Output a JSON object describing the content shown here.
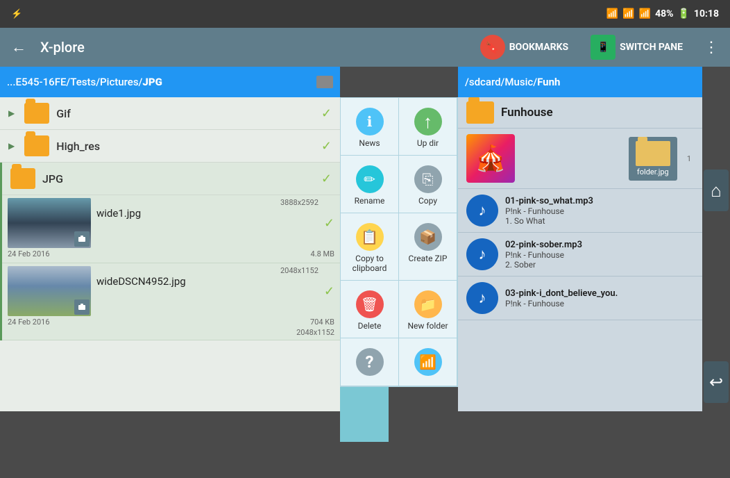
{
  "statusBar": {
    "usb_icon": "⚡",
    "bluetooth_icon": "bluetooth",
    "wifi_icon": "wifi",
    "signal_icon": "signal",
    "battery": "48%",
    "time": "10:18"
  },
  "appBar": {
    "back_label": "←",
    "title": "X-plore",
    "bookmarks_label": "BOOKMARKS",
    "switch_pane_label": "SWITCH PANE"
  },
  "leftPane": {
    "path": "...E545-16FE/Tests/Pictures/",
    "path_bold": "JPG",
    "folders": [
      {
        "name": "Gif"
      },
      {
        "name": "High_res"
      },
      {
        "name": "JPG"
      }
    ],
    "images": [
      {
        "name": "wide1",
        "ext": ".jpg",
        "dimensions": "3888x2592",
        "date": "24 Feb 2016",
        "size": "4.8 MB",
        "dim2": "2048x1152"
      },
      {
        "name": "wideDSCN4952",
        "ext": ".jpg",
        "dimensions": "2048x1152",
        "date": "24 Feb 2016",
        "size": "704 KB"
      }
    ]
  },
  "contextMenu": {
    "items": [
      {
        "id": "news",
        "label": "News",
        "icon": "ℹ",
        "color": "blue"
      },
      {
        "id": "up-dir",
        "label": "Up dir",
        "icon": "↑",
        "color": "green"
      },
      {
        "id": "rename",
        "label": "Rename",
        "icon": "✏",
        "color": "teal"
      },
      {
        "id": "copy",
        "label": "Copy",
        "icon": "⎘",
        "color": "grey"
      },
      {
        "id": "copy-clipboard",
        "label": "Copy to clipboard",
        "icon": "📋",
        "color": "clipboard"
      },
      {
        "id": "create-zip",
        "label": "Create ZIP",
        "icon": "🗜",
        "color": "grey"
      },
      {
        "id": "delete",
        "label": "Delete",
        "icon": "🗑",
        "color": "red"
      },
      {
        "id": "new-folder",
        "label": "New folder",
        "icon": "📁",
        "color": "folder-new"
      },
      {
        "id": "help",
        "label": "?",
        "icon": "?",
        "color": "question"
      },
      {
        "id": "wifi",
        "label": "wifi",
        "icon": "📶",
        "color": "wifi"
      }
    ]
  },
  "rightPane": {
    "path": "/sdcard/Music/",
    "path_bold": "Funh",
    "folder_name": "Funhouse",
    "folder_image_name": "folder.jpg",
    "music_items": [
      {
        "filename": "01-pink-so_what.mp3",
        "artist": "P!nk - Funhouse",
        "track": "1.  So What"
      },
      {
        "filename": "02-pink-sober.mp3",
        "artist": "P!nk - Funhouse",
        "track": "2.  Sober"
      },
      {
        "filename": "03-pink-i_dont_believe_you.",
        "artist": "P!nk - Funhouse",
        "track": ""
      }
    ]
  },
  "rightNav": {
    "home_icon": "⌂",
    "back_icon": "↩"
  }
}
